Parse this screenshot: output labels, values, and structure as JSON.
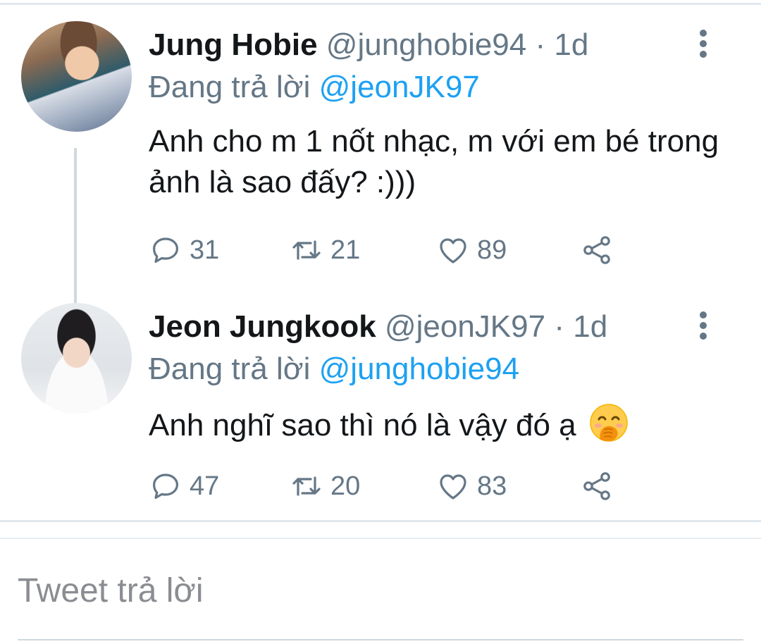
{
  "tweets": [
    {
      "name": "Jung Hobie",
      "handle": "@junghobie94",
      "separator": "·",
      "time": "1d",
      "replying_prefix": "Đang trả lời",
      "replying_to": "@jeonJK97",
      "text": "Anh cho m 1 nốt nhạc, m với em bé trong ảnh là sao đấy? :)))",
      "replies": "31",
      "retweets": "21",
      "likes": "89"
    },
    {
      "name": "Jeon Jungkook",
      "handle": "@jeonJK97",
      "separator": "·",
      "time": "1d",
      "replying_prefix": "Đang trả lời",
      "replying_to": "@junghobie94",
      "text": "Anh nghĩ sao thì nó là vậy đó ạ",
      "emoji": "face-with-hand-over-mouth",
      "replies": "47",
      "retweets": "20",
      "likes": "83"
    }
  ],
  "reply_box": {
    "placeholder": "Tweet trả lời"
  },
  "icons": {
    "reply": "reply-icon",
    "retweet": "retweet-icon",
    "like": "heart-icon",
    "share": "share-icon",
    "more": "more-vertical-icon"
  },
  "colors": {
    "text": "#14171a",
    "secondary": "#657786",
    "accent": "#1da1f2",
    "divider": "#e1e8ed"
  }
}
